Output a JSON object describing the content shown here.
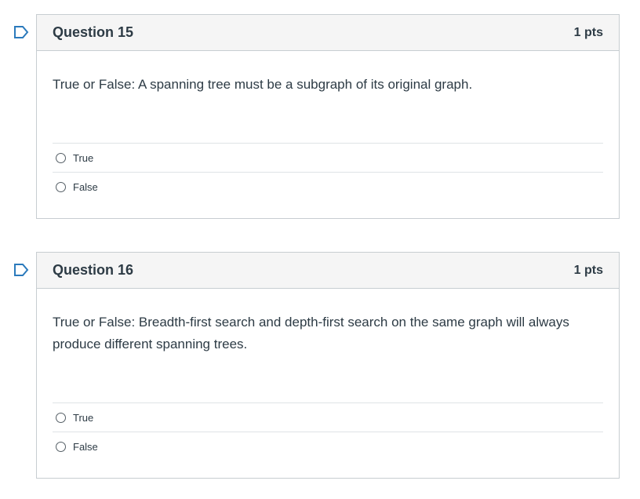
{
  "questions": [
    {
      "title": "Question 15",
      "points": "1 pts",
      "text": "True or False: A spanning tree must be a subgraph of its original graph.",
      "answers": [
        "True",
        "False"
      ]
    },
    {
      "title": "Question 16",
      "points": "1 pts",
      "text": "True or False: Breadth-first search and depth-first search on the same graph will always produce different spanning trees.",
      "answers": [
        "True",
        "False"
      ]
    }
  ],
  "colors": {
    "header_bg": "#f5f5f5",
    "border": "#c7cdd1",
    "text": "#2d3b45",
    "flag": "#2b7abc"
  }
}
